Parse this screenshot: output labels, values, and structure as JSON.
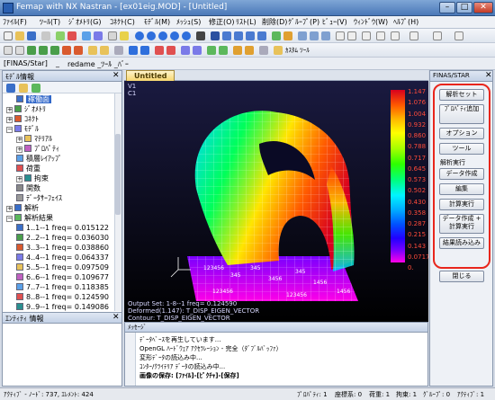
{
  "window": {
    "title": "Femap with NX Nastran - [ex01eig.MOD] - [Untitled]",
    "min": "–",
    "max": "□",
    "close": "✕"
  },
  "menu": [
    "ﾌｧｲﾙ(F)",
    "ﾂｰﾙ(T)",
    "ｼﾞｵﾒﾄﾘ(G)",
    "ｺﾈｸﾄ(C)",
    "ﾓﾃﾞﾙ(M)",
    "ﾒｯｼｭ(S)",
    "修正(O)",
    "ﾘｽﾄ(L)",
    "削除(D)",
    "ｸﾞﾙｰﾌﾟ(P)",
    "ﾋﾞｭｰ(V)",
    "ｳｨﾝﾄﾞｳ(W)",
    "ﾍﾙﾌﾟ(H)"
  ],
  "toolbar3": {
    "label": "[FINAS/Star]",
    "prefix": "_",
    "filter": "redame _ﾂｰﾙ _ﾊﾞｰ"
  },
  "toolbar2": {
    "custom_tool_label": "ｶｽﾀﾑ ﾂｰﾙ"
  },
  "left_panel": {
    "title": "ﾓﾃﾞﾙ情報",
    "close": "✕",
    "tree": [
      {
        "label": "稼働面",
        "level": 1,
        "selected": true
      },
      {
        "label": "ｼﾞｵﾒﾄﾘ",
        "level": 0,
        "toggle": "+"
      },
      {
        "label": "ｺﾈｸﾄ",
        "level": 0,
        "toggle": "+"
      },
      {
        "label": "ﾓﾃﾞﾙ",
        "level": 0,
        "toggle": "−"
      },
      {
        "label": "ﾏﾃﾘｱﾙ",
        "level": 1,
        "toggle": "+"
      },
      {
        "label": "ﾌﾟﾛﾊﾟﾃｨ",
        "level": 1,
        "toggle": "+"
      },
      {
        "label": "積層ﾚｲｱｯﾌﾟ",
        "level": 1
      },
      {
        "label": "荷重",
        "level": 1
      },
      {
        "label": "拘束",
        "level": 1,
        "toggle": "+"
      },
      {
        "label": "関数",
        "level": 1
      },
      {
        "label": "ﾃﾞｰﾀｻｰﾌｪｲｽ",
        "level": 1
      },
      {
        "label": "解析",
        "level": 0,
        "toggle": "+"
      },
      {
        "label": "解析結果",
        "level": 0,
        "toggle": "−"
      },
      {
        "label": "1..1--1 freq= 0.015122",
        "level": 1
      },
      {
        "label": "2..2--1 freq= 0.036030",
        "level": 1
      },
      {
        "label": "3..3--1 freq= 0.038860",
        "level": 1
      },
      {
        "label": "4..4--1 freq= 0.064337",
        "level": 1
      },
      {
        "label": "5..5--1 freq= 0.097509",
        "level": 1
      },
      {
        "label": "6..6--1 freq= 0.109677",
        "level": 1
      },
      {
        "label": "7..7--1 freq= 0.118385",
        "level": 1
      },
      {
        "label": "8..8--1 freq= 0.124590",
        "level": 1
      },
      {
        "label": "9..9--1 freq= 0.149086",
        "level": 1
      }
    ]
  },
  "entity_panel": {
    "title": "ｴﾝﾃｨﾃｨ 情報",
    "close": "✕"
  },
  "viewport": {
    "tab": "Untitled",
    "labels": [
      "V1",
      "C1"
    ],
    "legend": [
      "1.147",
      "1.076",
      "1.004",
      "0.932",
      "0.860",
      "0.788",
      "0.717",
      "0.645",
      "0.573",
      "0.502",
      "0.430",
      "0.358",
      "0.287",
      "0.215",
      "0.143",
      "0.0717",
      "0."
    ],
    "info": [
      "Output Set: 1-8--1 freq= 0.124590",
      "Deformed(1.147): T_DISP_EIGEN_VECTOR",
      "Contour: T_DISP_EIGEN_VECTOR"
    ],
    "mesh_ids": [
      "1456",
      "123456",
      "345",
      "3456"
    ]
  },
  "finas_panel": {
    "title": "FINAS/STAR",
    "close": "✕",
    "items": [
      {
        "label": "解析セット",
        "kind": "button"
      },
      {
        "label": "ﾌﾟﾛﾊﾟﾃｨ追加",
        "kind": "button"
      },
      {
        "label": "オプション",
        "kind": "button"
      },
      {
        "label": "ツール",
        "kind": "button"
      },
      {
        "label": "解析実行",
        "kind": "label"
      },
      {
        "label": "データ作成",
        "kind": "button"
      },
      {
        "label": "編集",
        "kind": "button"
      },
      {
        "label": "計算実行",
        "kind": "button"
      },
      {
        "label": "データ作成 + 計算実行",
        "kind": "button"
      },
      {
        "label": "結果読み込み",
        "kind": "button"
      },
      {
        "label": "閉じる",
        "kind": "button"
      }
    ]
  },
  "messages": {
    "title": "ﾒｯｾｰｼﾞ",
    "lines": [
      "ﾃﾞｰﾀﾍﾞｰｽを再生しています...",
      "OpenGL ﾊｰﾄﾞｳｪｱ ｱｸｾﾗﾚｰｼｮﾝ - 完全（ﾀﾞﾌﾞﾙﾊﾞｯﾌｧ）",
      "変形ﾃﾞｰﾀの読込み中...",
      "ｺﾝﾀｰ/ｸﾗｲﾃﾘｱ ﾃﾞｰﾀの読込み中...",
      "画像の保存: [ﾌｧｲﾙ]-[ﾋﾟｸﾁｬ]-[保存]"
    ]
  },
  "status": {
    "left": "ｱｸﾃｨﾌﾞ - ﾉｰﾄﾞ: 737, ｴﾚﾒﾝﾄ: 424",
    "items": [
      "ﾌﾟﾛﾊﾟﾃｨ: 1",
      "座標系: 0",
      "荷重: 1",
      "拘束: 1",
      "ｸﾞﾙｰﾌﾟ: 0",
      "ｱｸﾃｨﾌﾞ: 1"
    ]
  },
  "colors": {
    "accent_red": "#e8261c",
    "selection": "#3167c9",
    "tab_gold": "#f7d66f"
  }
}
